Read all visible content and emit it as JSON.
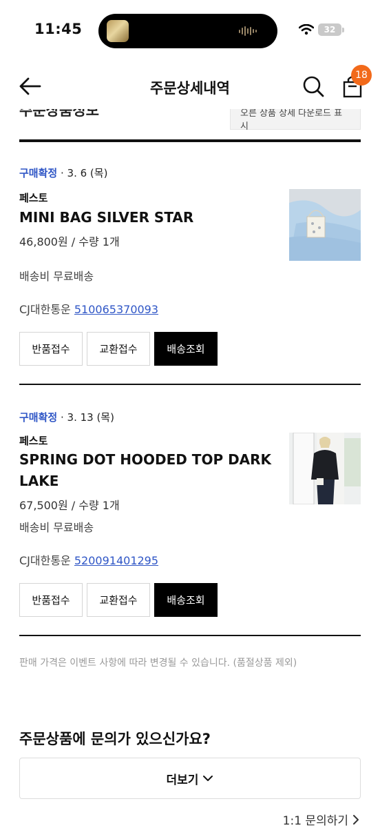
{
  "status_bar": {
    "time": "11:45",
    "battery": "32"
  },
  "header": {
    "title": "주문상세내역",
    "cart_count": "18"
  },
  "top_section": {
    "title_fragment": "주문상품정보",
    "box_fragment": "오른 상품 상세 다운로드 표시"
  },
  "orders": [
    {
      "status": "구매확정",
      "date": "· 3. 6 (목)",
      "brand": "페스토",
      "product_name": "MINI BAG SILVER STAR",
      "price_qty": "46,800원 / 수량 1개",
      "shipping": "배송비 무료배송",
      "courier": "CJ대한통운",
      "tracking": "510065370093",
      "buttons": [
        "반품접수",
        "교환접수",
        "배송조회"
      ]
    },
    {
      "status": "구매확정",
      "date": "· 3. 13 (목)",
      "brand": "페스토",
      "product_name": "SPRING DOT HOODED TOP DARK LAKE",
      "price_qty": "67,500원 / 수량 1개",
      "shipping": "배송비 무료배송",
      "courier": "CJ대한통운",
      "tracking": "520091401295",
      "buttons": [
        "반품접수",
        "교환접수",
        "배송조회"
      ]
    }
  ],
  "notice": "판매 가격은 이벤트 사항에 따라 변경될 수 있습니다. (품절상품 제외)",
  "inquiry": {
    "title": "주문상품에 문의가 있으신가요?",
    "more_label": "더보기",
    "link_label": "1:1 문의하기"
  },
  "colors": {
    "accent_blue": "#2f56c6",
    "badge_orange": "#f26a1b"
  },
  "icons": [
    "back-arrow-icon",
    "search-icon",
    "shopping-bag-icon",
    "chevron-down-icon",
    "chevron-right-icon",
    "wifi-icon"
  ]
}
